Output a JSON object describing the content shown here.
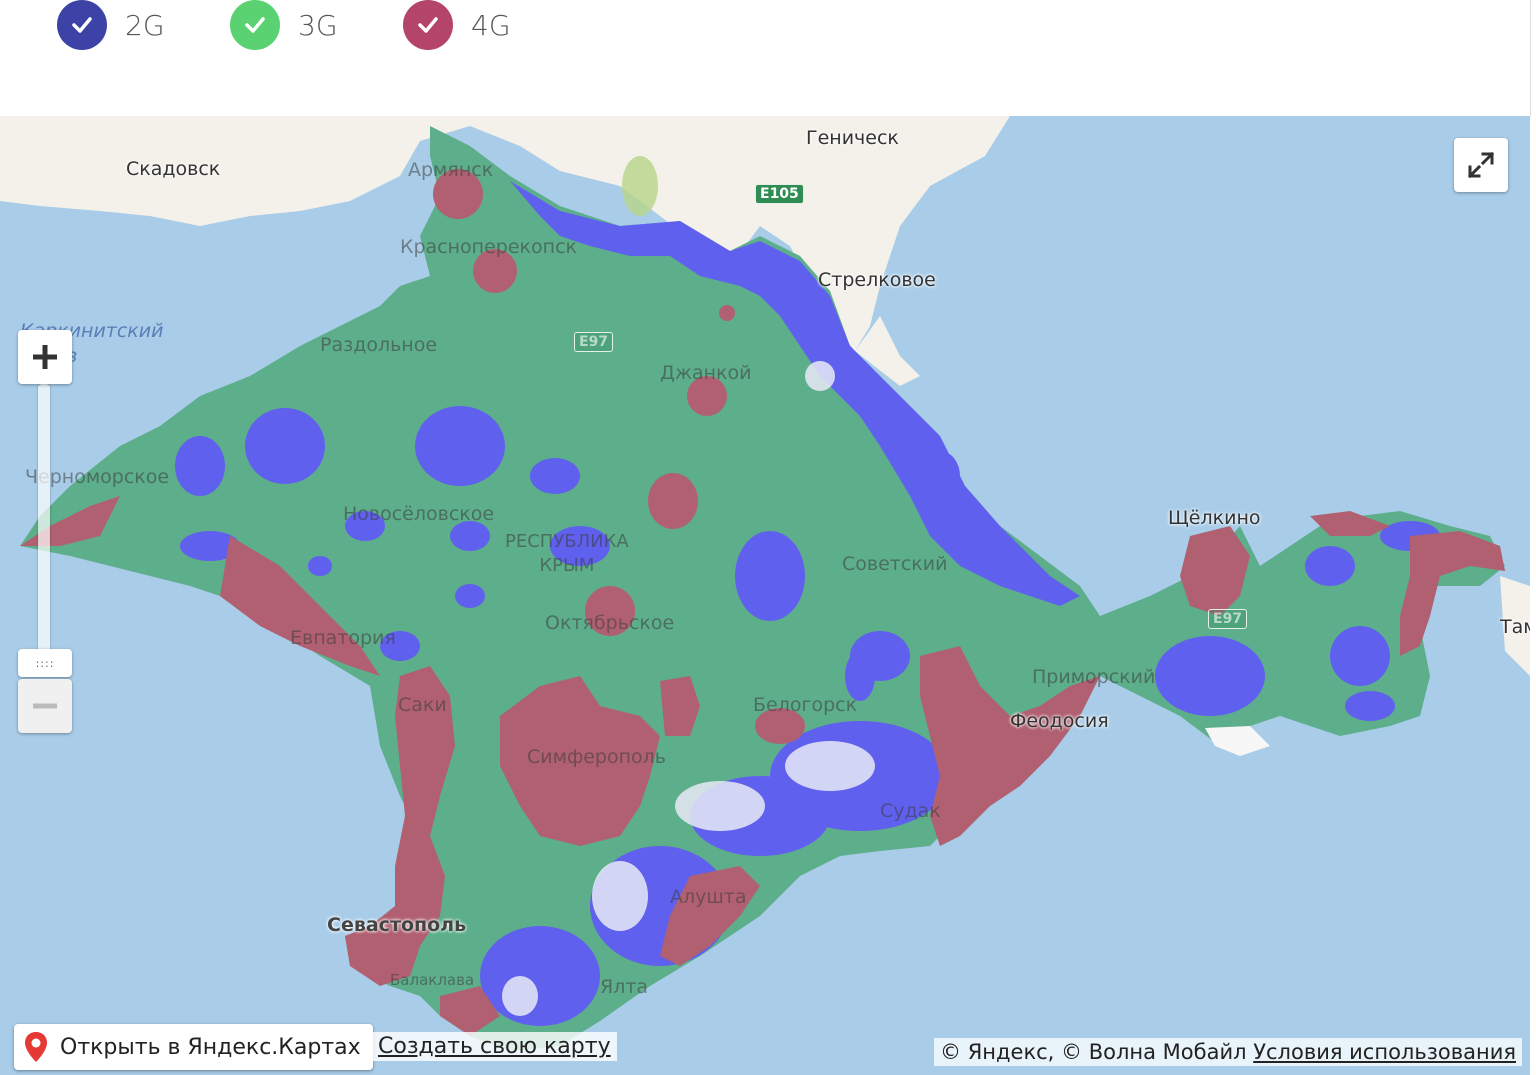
{
  "legend": [
    {
      "label": "2G",
      "color": "#3d43a6",
      "icon": "check-icon",
      "checked": true
    },
    {
      "label": "3G",
      "color": "#5ad272",
      "icon": "check-icon",
      "checked": true
    },
    {
      "label": "4G",
      "color": "#b4446a",
      "icon": "check-icon",
      "checked": true
    }
  ],
  "coverage_colors": {
    "2g": "#6060ee",
    "3g": "#5dae8b",
    "4g": "#b06070"
  },
  "map_labels": {
    "skadovsk": "Скадовск",
    "genichesk": "Геническ",
    "armyansk": "Армянск",
    "krasnoperekopsk": "Красноперекопск",
    "strelkovoe": "Стрелковое",
    "karkinitsky": "Каркинитский\nзалив",
    "razdolnoe": "Раздольное",
    "dzhankoy": "Джанкой",
    "chernomorskoe": "Черноморское",
    "novoselovskoe": "Новосёловское",
    "republic": "РЕСПУБЛИКА\nКРЫМ",
    "sovetsky": "Советский",
    "shchelkino": "Щёлкино",
    "aktyabrskoe": "Октябрьское",
    "evpatoria": "Евпатория",
    "saki": "Саки",
    "simferopol": "Симферополь",
    "belogorsk": "Белогорск",
    "primorsky": "Приморский",
    "feodosia": "Феодосия",
    "sevastopol": "Севастополь",
    "alushta": "Алушта",
    "yalta": "Ялта",
    "taman": "Там",
    "balaklava": "Балаклава",
    "sudak": "Судак"
  },
  "road_signs": {
    "e105": "E105",
    "e97": "E97",
    "e97b": "E97"
  },
  "controls": {
    "fullscreen": "expand-icon",
    "zoom_in": "plus-icon",
    "zoom_out": "minus-icon",
    "zoom_handle": "::::"
  },
  "footer": {
    "open_in_yandex": "Открыть в Яндекс.Картах",
    "create_map": "Создать свою карту",
    "copyright": "© Яндекс, © Волна Мобайл",
    "terms": "Условия использования"
  }
}
